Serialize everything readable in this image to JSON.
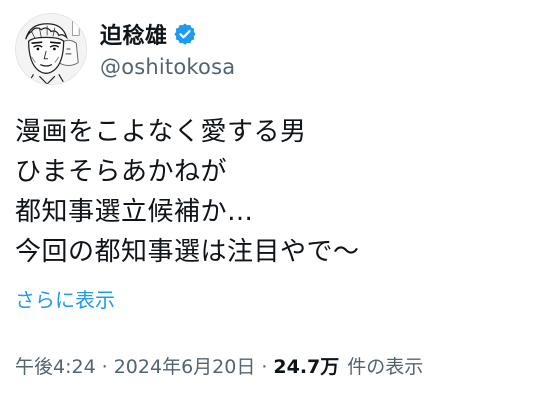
{
  "author": {
    "display_name": "迫稔雄",
    "handle": "@oshitokosa",
    "verified": true
  },
  "tweet": {
    "lines": [
      "漫画をこよなく愛する男",
      "ひまそらあかねが",
      "都知事選立候補か…",
      "今回の都知事選は注目やで～"
    ],
    "show_more": "さらに表示"
  },
  "meta": {
    "time": "午後4:24",
    "separator": "·",
    "date": "2024年6月20日",
    "views_count": "24.7万",
    "views_label": "件の表示"
  },
  "colors": {
    "text": "#0f1419",
    "secondary": "#536471",
    "link": "#1d9bf0",
    "verified_badge": "#1d9bf0"
  },
  "icons": {
    "verified": "verified-badge-icon"
  }
}
